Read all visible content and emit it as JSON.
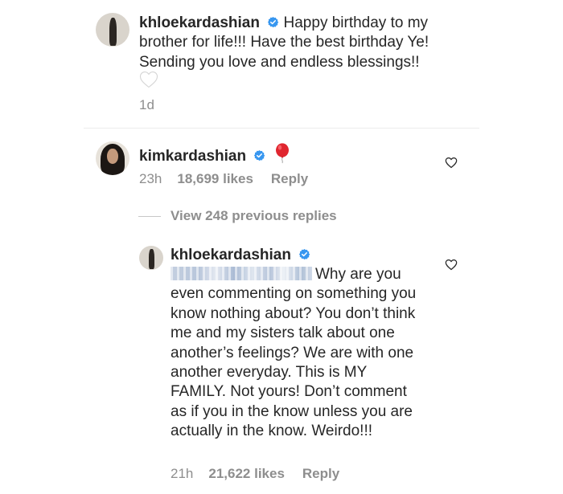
{
  "comment1": {
    "username": "khloekardashian",
    "text": "Happy birthday to my brother for life!!! Have the best birthday Ye! Sending you love and endless blessings!!",
    "emoji": "🤍",
    "time": "1d"
  },
  "comment2": {
    "username": "kimkardashian",
    "time": "23h",
    "likes": "18,699 likes",
    "reply": "Reply"
  },
  "view_replies": "View 248 previous replies",
  "comment3": {
    "username": "khloekardashian",
    "text": "Why are you even commenting on something you know nothing about? You don’t think me and my sisters talk about one another’s feelings? We are with one another everyday. This is MY FAMILY. Not yours! Don’t comment as if you in the know unless you are actually in the know. Weirdo!!!",
    "time": "21h",
    "likes": "21,622 likes",
    "reply": "Reply"
  },
  "colors": {
    "verified": "#3897f0",
    "meta_gray": "#8e8e8e",
    "text": "#262626",
    "balloon": "#e0262f"
  },
  "icons": [
    "verified-badge-icon",
    "red-balloon-icon",
    "heart-outline-icon",
    "white-heart-emoji"
  ]
}
